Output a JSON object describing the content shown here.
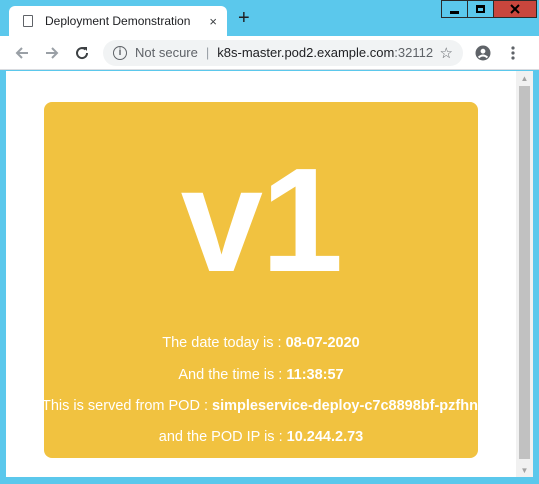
{
  "browser": {
    "tab_title": "Deployment Demonstration",
    "tab_close": "×",
    "new_tab": "+",
    "address": {
      "security_label": "Not secure",
      "separator": "|",
      "host": "k8s-master.pod2.example.com",
      "port": ":32112"
    },
    "icons": {
      "back": "arrow-left-icon",
      "forward": "arrow-right-icon",
      "reload": "reload-icon",
      "info": "info-icon",
      "bookmark": "star-icon",
      "account": "account-icon",
      "menu": "kebab-menu-icon"
    }
  },
  "page": {
    "version": "v1",
    "date_label": "The date today is : ",
    "date_value": "08-07-2020",
    "time_label": "And the time is : ",
    "time_value": "11:38:57",
    "pod_label": "This is served from POD : ",
    "pod_value": "simpleservice-deploy-c7c8898bf-pzfhn",
    "ip_label": "and the POD IP is : ",
    "ip_value": "10.244.2.73"
  },
  "colors": {
    "window_frame": "#5bc8ec",
    "card_background": "#f1c240",
    "card_text": "#ffffff",
    "close_button": "#c9463d"
  }
}
